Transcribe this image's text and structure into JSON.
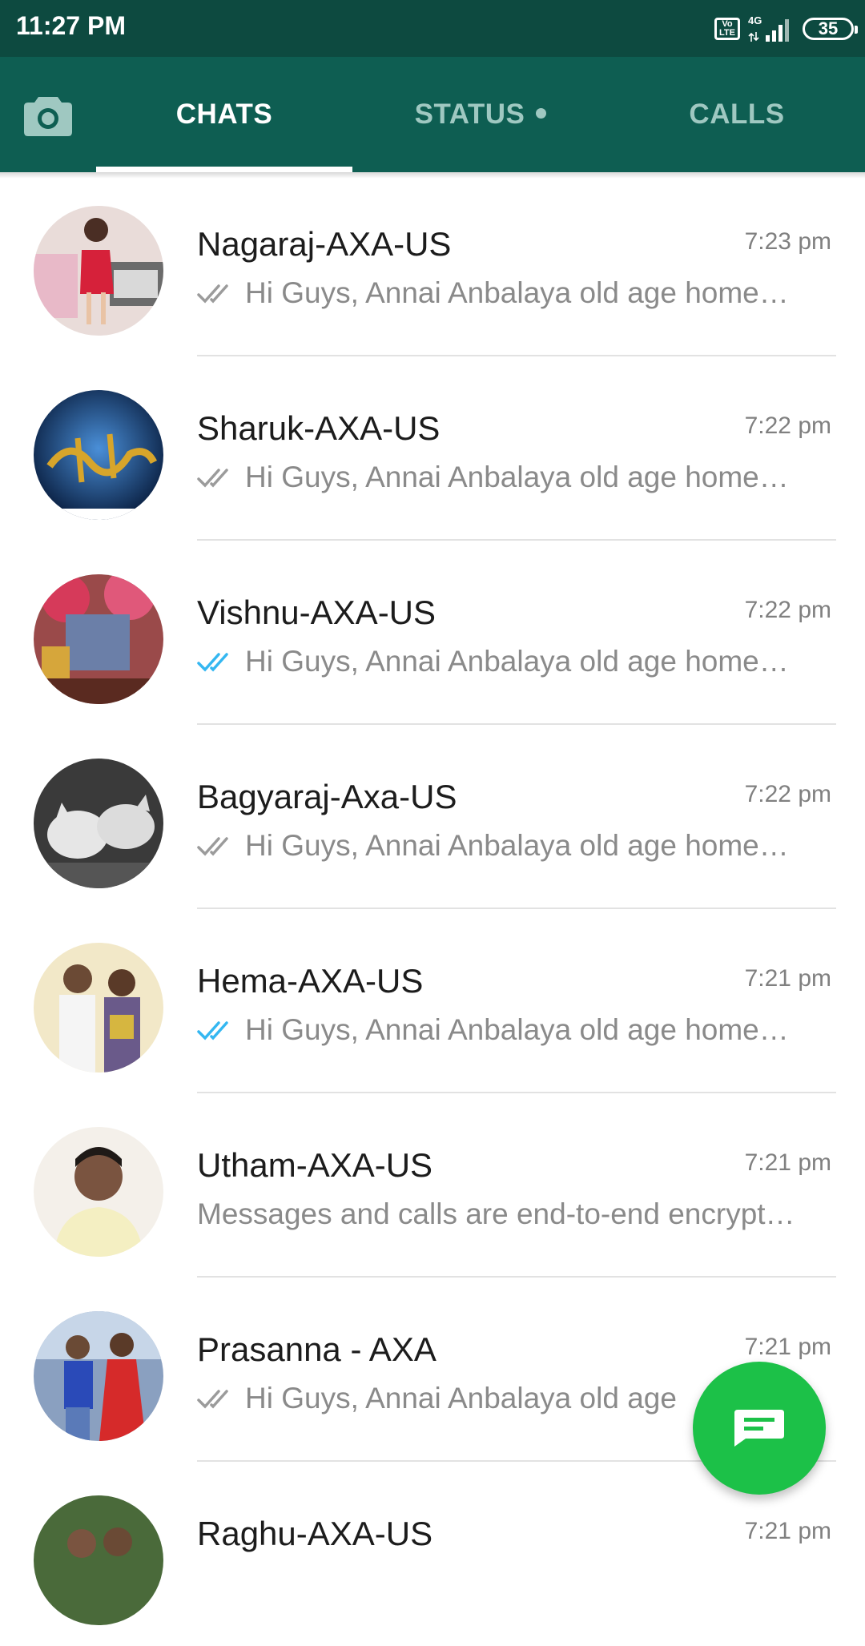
{
  "status_bar": {
    "time": "11:27 PM",
    "volte_top": "Vo",
    "volte_bottom": "LTE",
    "network": "4G",
    "battery": "35"
  },
  "tabs": {
    "chats": "CHATS",
    "status": "STATUS",
    "calls": "CALLS",
    "active": "chats"
  },
  "colors": {
    "header": "#0e5e52",
    "status_bar": "#0d4a40",
    "fab": "#1cc148",
    "read_ticks": "#34b7f1",
    "sent_ticks": "#9b9b9b"
  },
  "chats": [
    {
      "name": "Nagaraj-AXA-US",
      "time": "7:23 pm",
      "preview": "Hi Guys,  Annai Anbalaya old age home…",
      "ticks": "delivered"
    },
    {
      "name": "Sharuk-AXA-US",
      "time": "7:22 pm",
      "preview": "Hi Guys,  Annai Anbalaya old age home…",
      "ticks": "delivered"
    },
    {
      "name": "Vishnu-AXA-US",
      "time": "7:22 pm",
      "preview": "Hi Guys,  Annai Anbalaya old age home…",
      "ticks": "read"
    },
    {
      "name": "Bagyaraj-Axa-US",
      "time": "7:22 pm",
      "preview": "Hi Guys,  Annai Anbalaya old age home…",
      "ticks": "delivered"
    },
    {
      "name": "Hema-AXA-US",
      "time": "7:21 pm",
      "preview": "Hi Guys,  Annai Anbalaya old age home…",
      "ticks": "read"
    },
    {
      "name": "Utham-AXA-US",
      "time": "7:21 pm",
      "preview": "Messages and calls are end-to-end encrypt…",
      "ticks": "none"
    },
    {
      "name": "Prasanna - AXA",
      "time": "7:21 pm",
      "preview": "Hi Guys,  Annai Anbalaya old age",
      "ticks": "delivered"
    },
    {
      "name": "Raghu-AXA-US",
      "time": "7:21 pm",
      "preview": "",
      "ticks": "none"
    }
  ],
  "fab": {
    "icon": "new-chat-icon"
  }
}
